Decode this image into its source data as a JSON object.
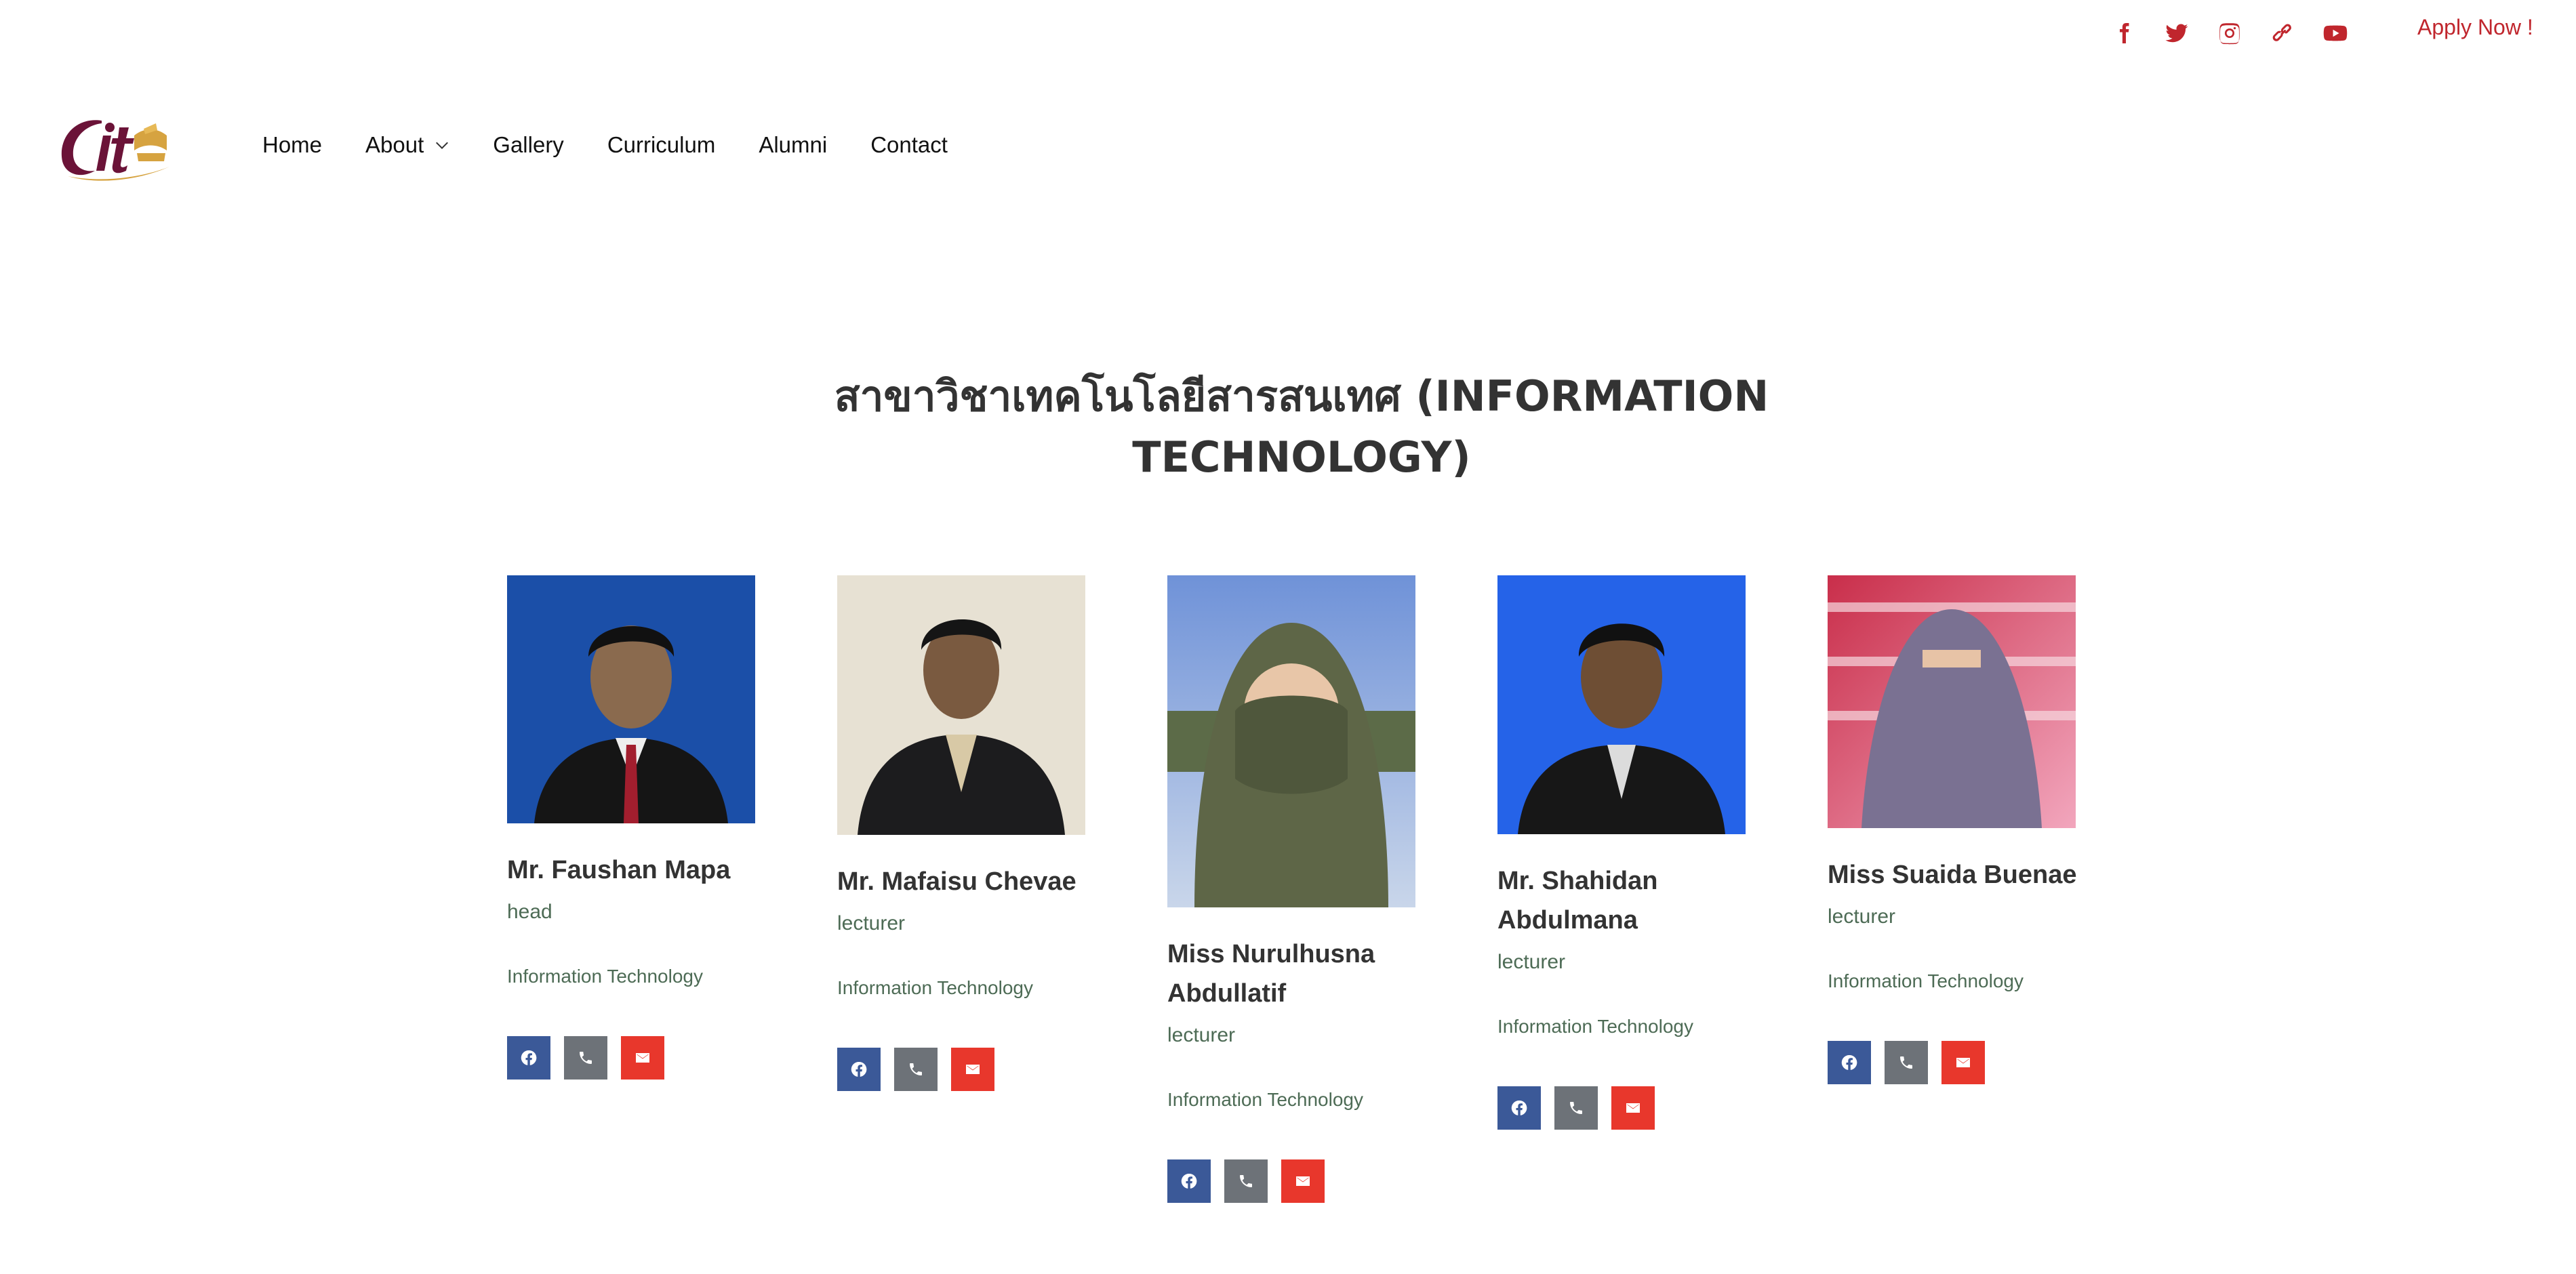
{
  "topbar": {
    "social_icons": [
      "facebook-icon",
      "twitter-icon",
      "instagram-icon",
      "link-icon",
      "youtube-icon"
    ],
    "apply_label": "Apply Now !",
    "accent_color": "#c0262d"
  },
  "header": {
    "logo_text": "cit",
    "nav": [
      {
        "label": "Home"
      },
      {
        "label": "About",
        "has_dropdown": true
      },
      {
        "label": "Gallery"
      },
      {
        "label": "Curriculum"
      },
      {
        "label": "Alumni"
      },
      {
        "label": "Contact"
      }
    ]
  },
  "section": {
    "title_line1": "สาขาวิชาเทคโนโลยีสารสนเทศ (INFORMATION",
    "title_line2": "TECHNOLOGY)"
  },
  "staff": [
    {
      "name": "Mr. Faushan Mapa",
      "role": "head",
      "department": "Information Technology"
    },
    {
      "name": "Mr. Mafaisu Chevae",
      "role": "lecturer",
      "department": "Information Technology"
    },
    {
      "name_line1": "Miss Nurulhusna",
      "name_line2": "Abdullatif",
      "role": "lecturer",
      "department": "Information Technology"
    },
    {
      "name_line1": "Mr. Shahidan",
      "name_line2": "Abdulmana",
      "role": "lecturer",
      "department": "Information Technology"
    },
    {
      "name": "Miss Suaida Buenae",
      "role": "lecturer",
      "department": "Information Technology"
    }
  ],
  "button_colors": {
    "facebook": "#3b5998",
    "phone": "#6d7278",
    "email": "#e8372c"
  }
}
